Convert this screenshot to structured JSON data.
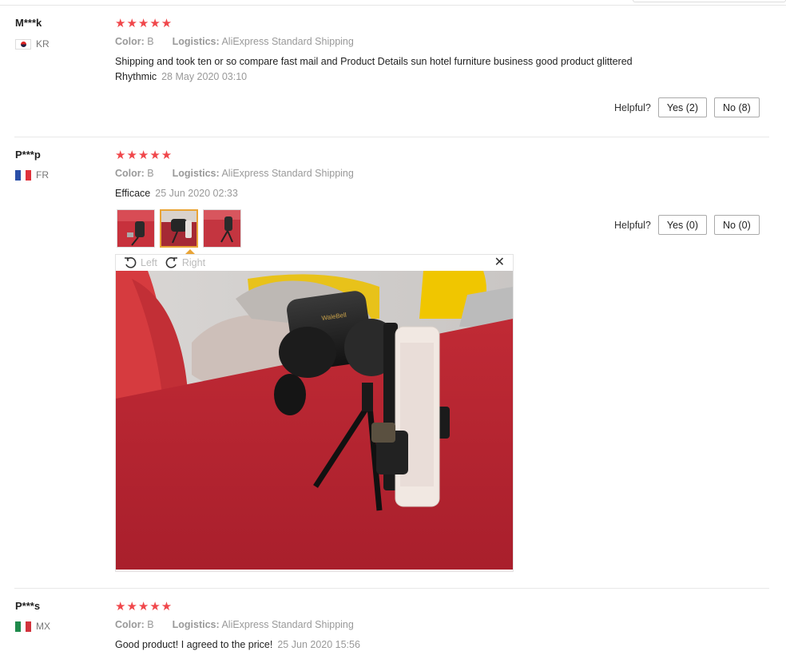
{
  "reviews": [
    {
      "user": "M***k",
      "country": "KR",
      "stars": "★★★★★",
      "color_label": "Color:",
      "color_value": "B",
      "logistics_label": "Logistics:",
      "logistics_value": "AliExpress Standard Shipping",
      "text": "Shipping and took ten or so compare fast mail and Product Details sun hotel furniture business good product glittered",
      "text2": "Rhythmic",
      "date": "28 May 2020 03:10",
      "helpful_label": "Helpful?",
      "yes": "Yes (2)",
      "no": "No (8)"
    },
    {
      "user": "P***p",
      "country": "FR",
      "stars": "★★★★★",
      "color_label": "Color:",
      "color_value": "B",
      "logistics_label": "Logistics:",
      "logistics_value": "AliExpress Standard Shipping",
      "text": "Efficace",
      "date": "25 Jun 2020 02:33",
      "helpful_label": "Helpful?",
      "yes": "Yes (0)",
      "no": "No (0)",
      "viewer": {
        "left_label": "Left",
        "right_label": "Right",
        "close": "✕"
      }
    },
    {
      "user": "P***s",
      "country": "MX",
      "stars": "★★★★★",
      "color_label": "Color:",
      "color_value": "B",
      "logistics_label": "Logistics:",
      "logistics_value": "AliExpress Standard Shipping",
      "text": "Good product! I agreed to the price!",
      "date": "25 Jun 2020 15:56"
    }
  ],
  "icons": {
    "star": "star-icon",
    "rotate_left": "rotate-left-icon",
    "rotate_right": "rotate-right-icon",
    "close": "close-icon"
  },
  "colors": {
    "star": "#f0474b",
    "active_thumb": "#e9a436"
  }
}
